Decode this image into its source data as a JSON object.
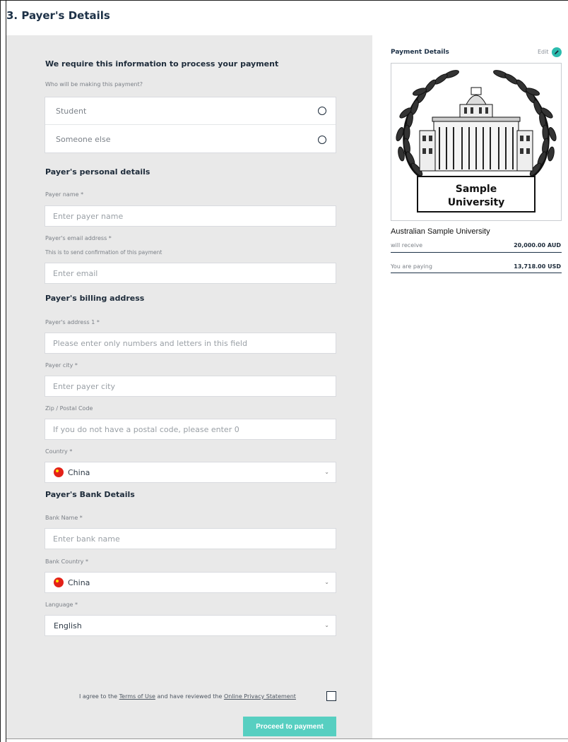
{
  "page": {
    "title": "3. Payer's Details"
  },
  "form": {
    "intro_heading": "We require this information to process your payment",
    "who_pays_label": "Who will be making this payment?",
    "payer_options": [
      "Student",
      "Someone else"
    ],
    "personal_heading": "Payer's personal details",
    "payer_name": {
      "label": "Payer name *",
      "placeholder": "Enter payer name"
    },
    "email": {
      "label": "Payer's email address *",
      "hint": "This is to send confirmation of this payment",
      "placeholder": "Enter email"
    },
    "billing_heading": "Payer's billing address",
    "address1": {
      "label": "Payer's address 1 *",
      "placeholder": "Please enter only numbers and letters in this field"
    },
    "city": {
      "label": "Payer city *",
      "placeholder": "Enter payer city"
    },
    "zip": {
      "label": "Zip / Postal Code",
      "placeholder": "If you do not have a postal code, please enter 0"
    },
    "country": {
      "label": "Country *",
      "value": "China"
    },
    "bank_heading": "Payer's Bank Details",
    "bank_name": {
      "label": "Bank Name *",
      "placeholder": "Enter bank name"
    },
    "bank_country": {
      "label": "Bank Country *",
      "value": "China"
    },
    "language": {
      "label": "Language *",
      "value": "English"
    },
    "agree": {
      "prefix": "I agree to the ",
      "terms": "Terms of Use",
      "middle": " and have reviewed the ",
      "privacy": "Online Privacy Statement"
    },
    "proceed_label": "Proceed to payment"
  },
  "sidebar": {
    "title": "Payment Details",
    "edit_label": "Edit",
    "logo_text_line1": "Sample",
    "logo_text_line2": "University",
    "institution": "Australian Sample University",
    "will_receive_label": "will receive",
    "will_receive_value": "20,000.00 AUD",
    "paying_label": "You are paying",
    "paying_value": "13,718.00 USD"
  },
  "colors": {
    "accent": "#57cfc1",
    "edit_icon": "#2cbcae",
    "panel_bg": "#e9e9e9",
    "heading": "#1d3147"
  },
  "icons": {
    "radio": "radio-circle",
    "dropdown": "chevron-down-icon",
    "flag": "china-flag-icon",
    "edit": "pencil-icon"
  }
}
